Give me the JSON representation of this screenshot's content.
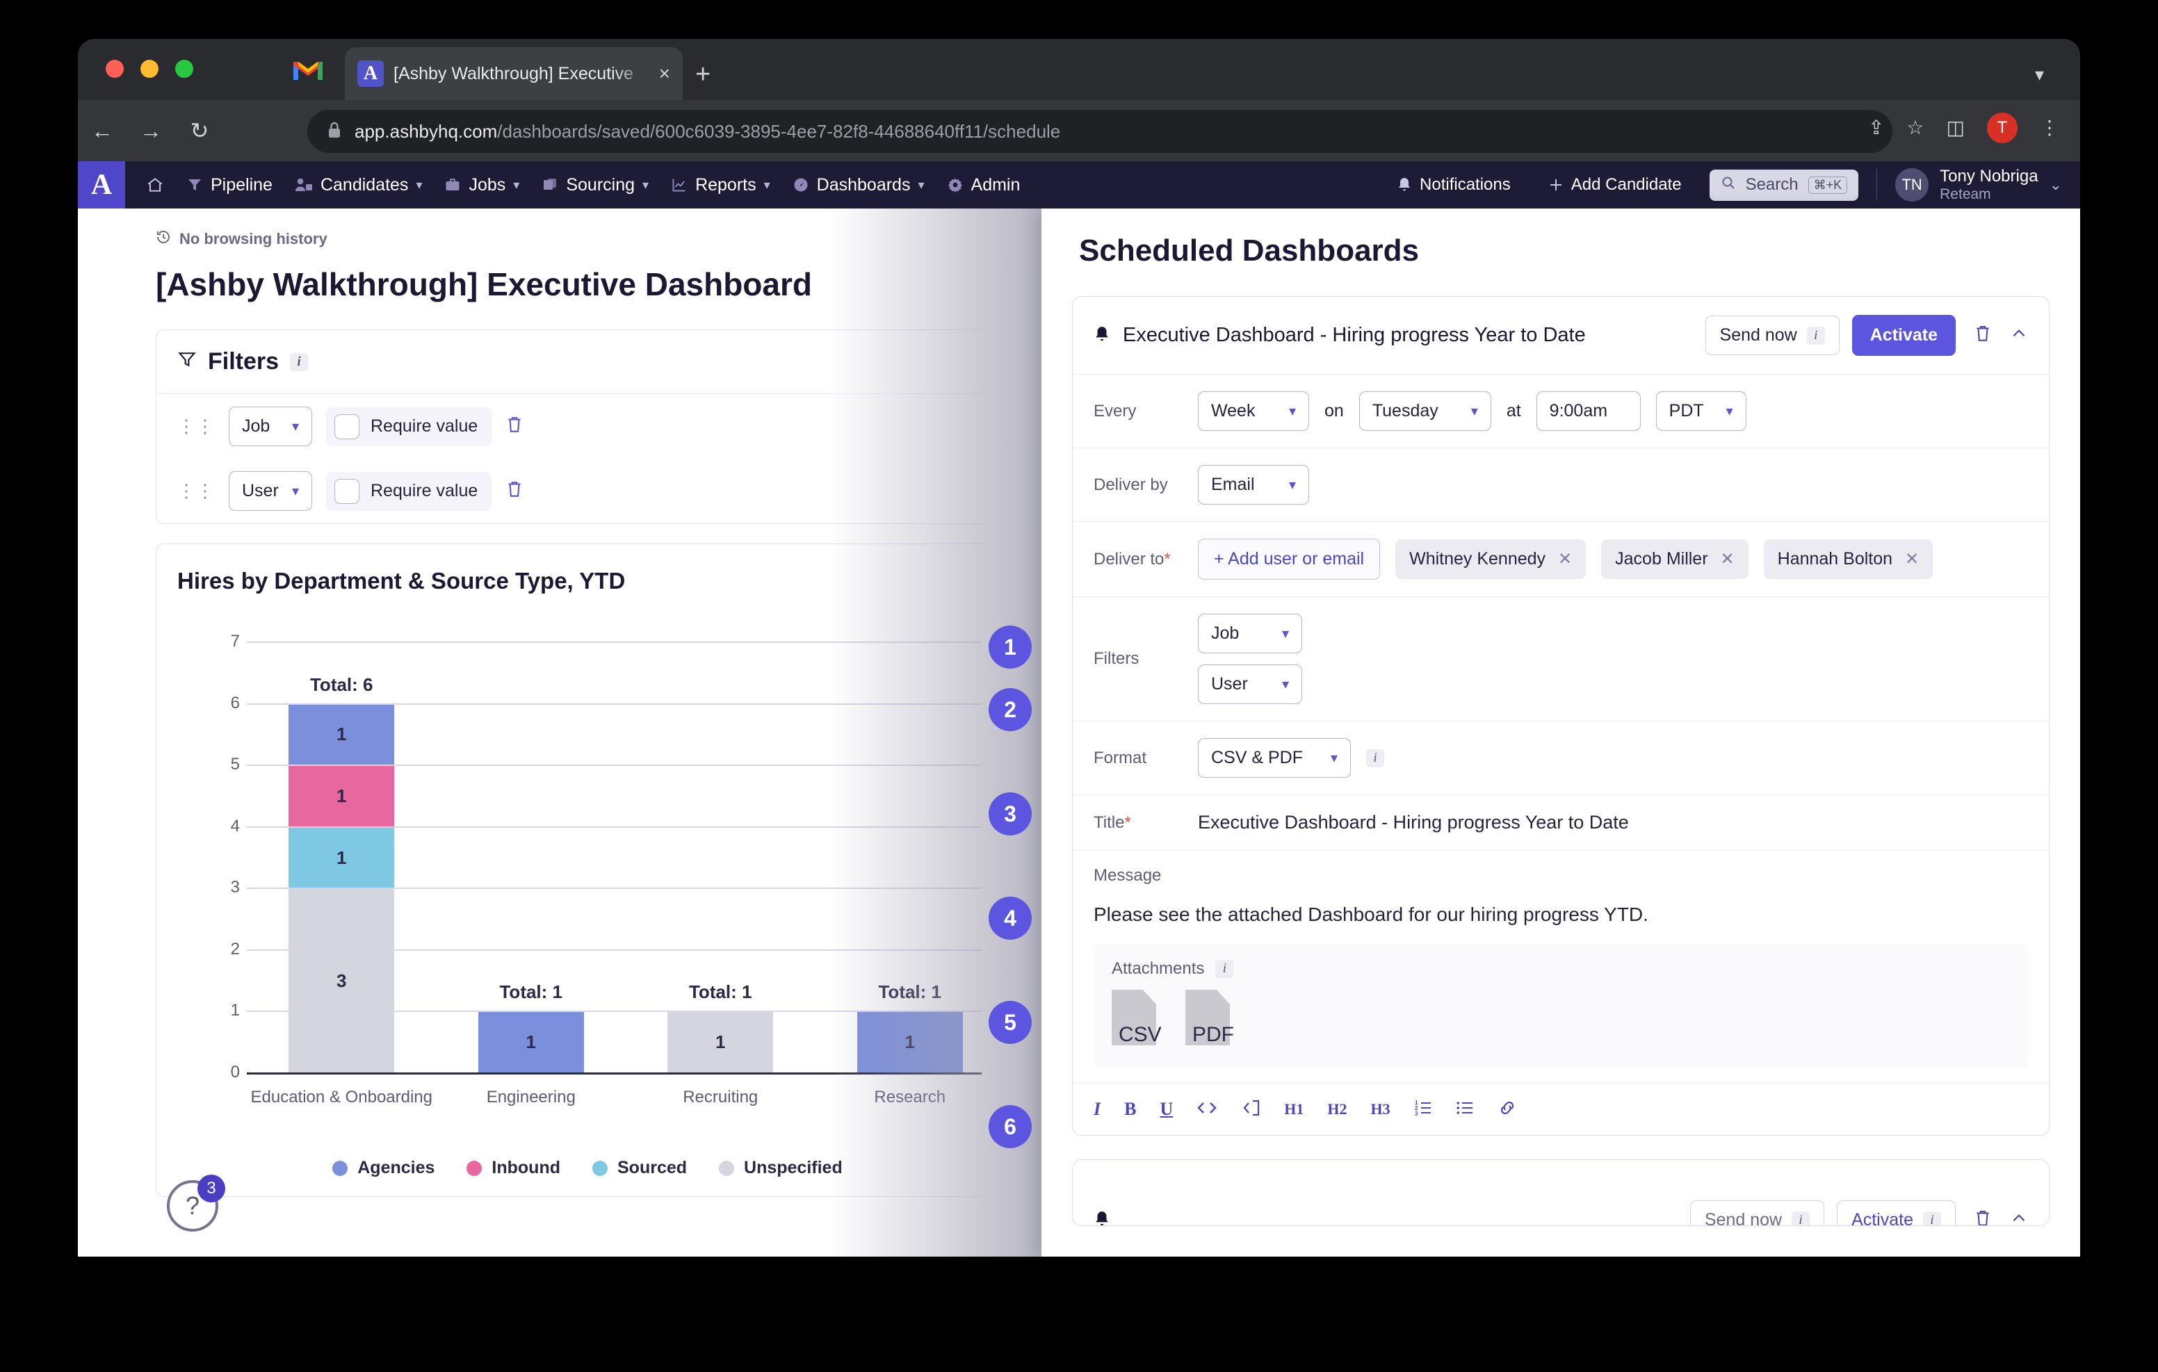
{
  "browser": {
    "tab_title": "[Ashby Walkthrough] Executive",
    "tab_favicon_letter": "A",
    "new_tab_label": "+",
    "close_tab_label": "×",
    "url_host": "app.ashbyhq.com",
    "url_path": "/dashboards/saved/600c6039-3895-4ee7-82f8-44688640ff11/schedule",
    "profile_initial": "T"
  },
  "nav": {
    "logo_letter": "A",
    "items": [
      {
        "label": "",
        "icon": "home-icon",
        "caret": false
      },
      {
        "label": "Pipeline",
        "icon": "funnel-icon",
        "caret": false
      },
      {
        "label": "Candidates",
        "icon": "people-icon",
        "caret": true
      },
      {
        "label": "Jobs",
        "icon": "briefcase-icon",
        "caret": true
      },
      {
        "label": "Sourcing",
        "icon": "sourcing-icon",
        "caret": true
      },
      {
        "label": "Reports",
        "icon": "chart-icon",
        "caret": true
      },
      {
        "label": "Dashboards",
        "icon": "gauge-icon",
        "caret": true
      },
      {
        "label": "Admin",
        "icon": "gear-icon",
        "caret": false
      }
    ],
    "notifications_label": "Notifications",
    "add_candidate_label": "Add Candidate",
    "search_label": "Search",
    "search_shortcut": "⌘+K",
    "user_initials": "TN",
    "user_name": "Tony Nobriga",
    "user_org": "Reteam",
    "caret": "⌄"
  },
  "left": {
    "browsing_history": "No browsing history",
    "dashboard_title": "[Ashby Walkthrough] Executive Dashboard",
    "close_label": "✕",
    "filters": {
      "heading": "Filters",
      "info": "i",
      "rows": [
        {
          "field": "Job",
          "require_label": "Require value",
          "required": false
        },
        {
          "field": "User",
          "require_label": "Require value",
          "required": false
        }
      ]
    },
    "help": {
      "glyph": "?",
      "badge": "3"
    }
  },
  "chart_data": {
    "type": "bar",
    "subtype": "stacked",
    "title": "Hires by Department & Source Type, YTD",
    "xlabel": "",
    "ylabel": "",
    "ylim": [
      0,
      7
    ],
    "yticks": [
      0,
      1,
      2,
      3,
      4,
      5,
      6,
      7
    ],
    "grid": true,
    "legend_position": "bottom",
    "categories": [
      "Education & Onboarding",
      "Engineering",
      "Recruiting",
      "Research"
    ],
    "totals": [
      "Total: 6",
      "Total: 1",
      "Total: 1",
      "Total: 1"
    ],
    "total_values": [
      6,
      1,
      1,
      1
    ],
    "series": [
      {
        "name": "Agencies",
        "color": "#7b8fdd",
        "values": [
          1,
          1,
          0,
          1
        ]
      },
      {
        "name": "Inbound",
        "color": "#e8679f",
        "values": [
          1,
          0,
          0,
          0
        ]
      },
      {
        "name": "Sourced",
        "color": "#7ec8e3",
        "values": [
          1,
          0,
          0,
          0
        ]
      },
      {
        "name": "Unspecified",
        "color": "#d5d5e0",
        "values": [
          3,
          0,
          1,
          0
        ]
      }
    ],
    "legend": [
      "Agencies",
      "Inbound",
      "Sourced",
      "Unspecified"
    ]
  },
  "step_badges": [
    "1",
    "2",
    "3",
    "4",
    "5",
    "6"
  ],
  "panel": {
    "title": "Scheduled Dashboards",
    "schedule": {
      "name": "Executive Dashboard - Hiring progress Year to Date",
      "send_now_label": "Send now",
      "send_now_info": "i",
      "activate_label": "Activate",
      "trash_icon": "trash-icon",
      "collapse_icon": "chevron-up-icon",
      "every_label": "Every",
      "frequency": "Week",
      "on_word": "on",
      "day": "Tuesday",
      "at_word": "at",
      "time": "9:00am",
      "timezone": "PDT",
      "deliver_by_label": "Deliver by",
      "deliver_by": "Email",
      "deliver_to_label": "Deliver to",
      "deliver_to_required": "*",
      "add_recipient_label": "+ Add user or email",
      "recipients": [
        "Whitney Kennedy",
        "Jacob Miller",
        "Hannah Bolton"
      ],
      "filters_label": "Filters",
      "filters": [
        "Job",
        "User"
      ],
      "format_label": "Format",
      "format": "CSV & PDF",
      "format_info": "i",
      "title_label": "Title",
      "title_required": "*",
      "title_value": "Executive Dashboard - Hiring progress Year to Date",
      "message_label": "Message",
      "message_value": "Please see the attached Dashboard for our hiring progress YTD.",
      "attachments_label": "Attachments",
      "attachments_info": "i",
      "attachments": [
        "CSV",
        "PDF"
      ],
      "toolbar": [
        "I",
        "B",
        "U",
        "</>",
        "‹ⁿ⌉",
        "H1",
        "H2",
        "H3",
        "ordered-list",
        "bullet-list",
        "link"
      ]
    },
    "schedule_partial": {
      "send_now_label": "Send now",
      "send_now_info": "i",
      "activate_label": "Activate",
      "activate_info": "i"
    }
  }
}
